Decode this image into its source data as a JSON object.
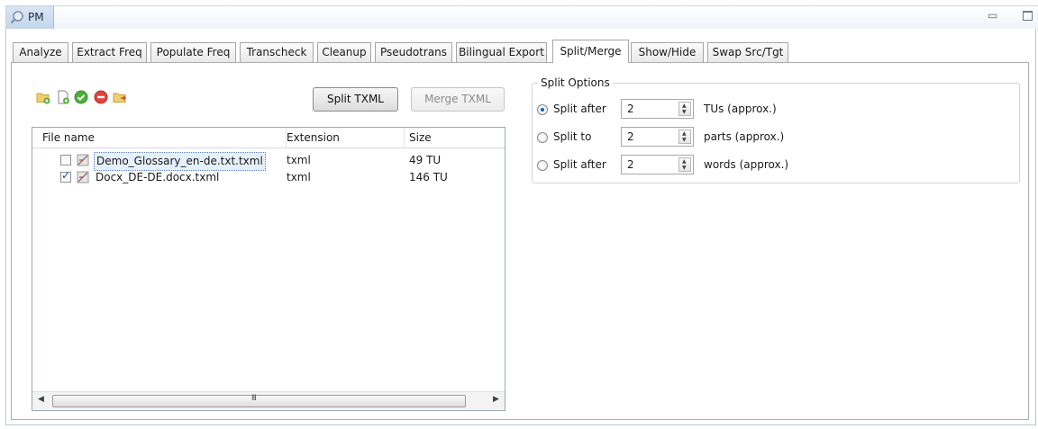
{
  "view": {
    "title": "PM",
    "icon": "magnifier-icon",
    "minimize": "minimize-icon",
    "maximize": "maximize-icon"
  },
  "tabs": [
    {
      "label": "Analyze"
    },
    {
      "label": "Extract Freq"
    },
    {
      "label": "Populate Freq"
    },
    {
      "label": "Transcheck"
    },
    {
      "label": "Cleanup"
    },
    {
      "label": "Pseudotrans"
    },
    {
      "label": "Bilingual Export"
    },
    {
      "label": "Split/Merge",
      "active": true
    },
    {
      "label": "Show/Hide"
    },
    {
      "label": "Swap Src/Tgt"
    }
  ],
  "toolbar": {
    "icons": [
      "add-folder-icon",
      "add-file-icon",
      "check-all-icon",
      "remove-icon",
      "open-folder-icon"
    ],
    "split_label": "Split TXML",
    "merge_label": "Merge TXML"
  },
  "table": {
    "headers": {
      "name": "File name",
      "ext": "Extension",
      "size": "Size"
    },
    "rows": [
      {
        "name": "Demo_Glossary_en-de.txt.txml",
        "ext": "txml",
        "size": "49 TU",
        "checked": false,
        "selected": true
      },
      {
        "name": "Docx_DE-DE.docx.txml",
        "ext": "txml",
        "size": "146 TU",
        "checked": true,
        "selected": false
      }
    ],
    "scroll_grip": "III"
  },
  "split_options": {
    "legend": "Split Options",
    "options": [
      {
        "label": "Split after",
        "value": "2",
        "unit": "TUs (approx.)",
        "selected": true
      },
      {
        "label": "Split to",
        "value": "2",
        "unit": "parts (approx.)",
        "selected": false
      },
      {
        "label": "Split after",
        "value": "2",
        "unit": "words (approx.)",
        "selected": false
      }
    ]
  },
  "colors": {
    "accent": "#1e5bb8",
    "view_tab": "#c3d5ea"
  }
}
